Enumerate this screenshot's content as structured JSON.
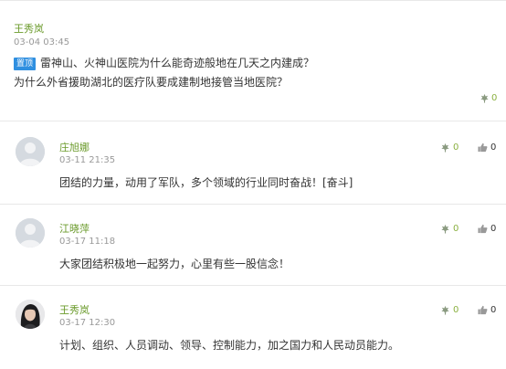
{
  "topic": {
    "author": "王秀岚",
    "time": "03-04 03:45",
    "pin_label": "置顶",
    "line1": "雷神山、火神山医院为什么能奇迹般地在几天之内建成？",
    "line2": "为什么外省援助湖北的医疗队要成建制地接管当地医院？",
    "likes": "0"
  },
  "replies": [
    {
      "author": "庄旭娜",
      "time": "03-11 21:35",
      "text": "团结的力量，动用了军队，多个领域的行业同时奋战！[奋斗]",
      "likes": "0",
      "thumbs": "0",
      "avatar": "default"
    },
    {
      "author": "江晓萍",
      "time": "03-17 11:18",
      "text": "大家团结积极地一起努力，心里有些一股信念！",
      "likes": "0",
      "thumbs": "0",
      "avatar": "default"
    },
    {
      "author": "王秀岚",
      "time": "03-17 12:30",
      "text": "计划、组织、人员调动、领导、控制能力，加之国力和人民动员能力。",
      "likes": "0",
      "thumbs": "0",
      "avatar": "photo"
    }
  ],
  "icons": {
    "like": "flower-like-icon",
    "thumb": "thumbs-up-icon"
  },
  "colors": {
    "author": "#6a9a2a",
    "pin_badge": "#2f8fe0",
    "like": "#8ab040"
  }
}
